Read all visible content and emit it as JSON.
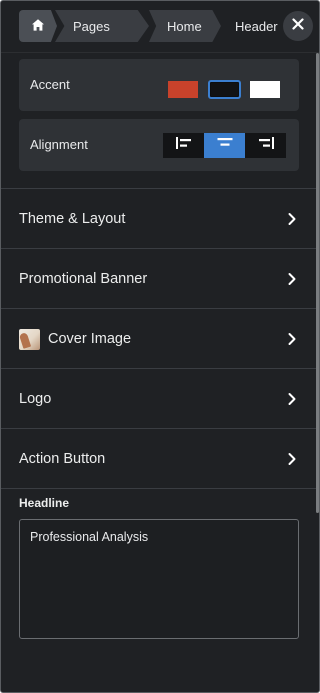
{
  "breadcrumb": {
    "home_icon": "home-icon",
    "items": [
      "Pages",
      "Home",
      "Header"
    ]
  },
  "close_icon": "close-icon",
  "accent": {
    "label": "Accent",
    "swatches": [
      "#c8422b",
      "#111214",
      "#ffffff"
    ],
    "selected": "#111214"
  },
  "alignment": {
    "label": "Alignment",
    "options": [
      "align-left-icon",
      "align-center-icon",
      "align-right-icon"
    ],
    "selected": "align-center-icon"
  },
  "rows": [
    {
      "label": "Theme & Layout"
    },
    {
      "label": "Promotional Banner"
    },
    {
      "label": "Cover Image"
    },
    {
      "label": "Logo"
    },
    {
      "label": "Action Button"
    }
  ],
  "headline": {
    "label": "Headline",
    "value": "Professional Analysis"
  },
  "colors": {
    "accent_blue": "#3b7fd0",
    "panel_bg": "#1f2124"
  }
}
